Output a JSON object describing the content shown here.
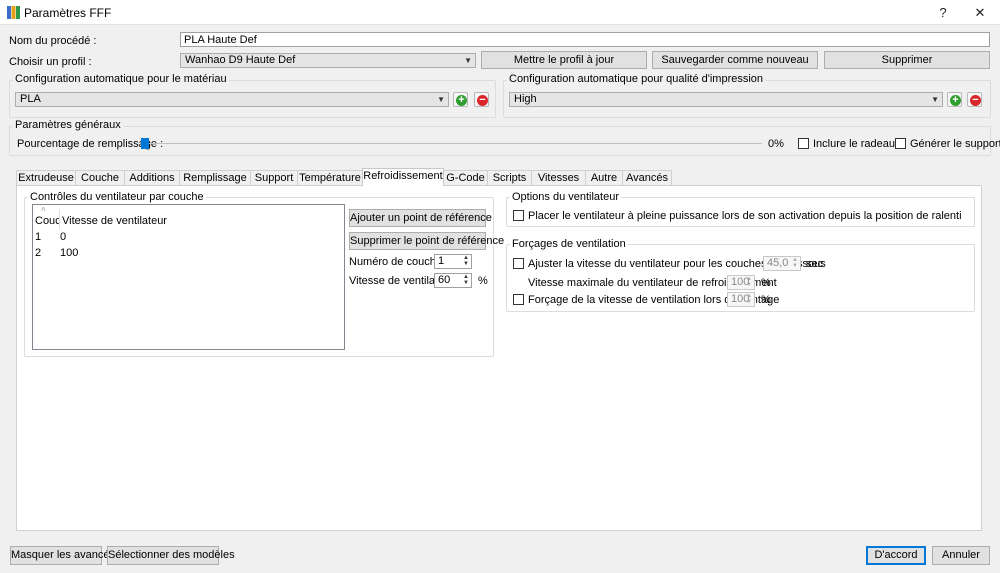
{
  "window": {
    "title": "Paramètres FFF",
    "help_glyph": "?",
    "close_glyph": "✕"
  },
  "process": {
    "name_label": "Nom du procédé :",
    "name_value": "PLA Haute Def"
  },
  "profile": {
    "label": "Choisir un profil :",
    "value": "Wanhao D9 Haute Def",
    "update_button": "Mettre le profil à jour",
    "save_new_button": "Sauvegarder comme nouveau",
    "delete_button": "Supprimer"
  },
  "material": {
    "group_title": "Configuration automatique pour le matériau",
    "value": "PLA"
  },
  "quality": {
    "group_title": "Configuration automatique pour qualité d'impression",
    "value": "High"
  },
  "general": {
    "group_title": "Paramètres généraux",
    "infill_label": "Pourcentage de remplissage :",
    "infill_percent": 0,
    "infill_text": "0%",
    "raft_label": "Inclure le radeau",
    "support_label": "Générer le support"
  },
  "tabs": [
    {
      "label": "Extrudeuse"
    },
    {
      "label": "Couche"
    },
    {
      "label": "Additions"
    },
    {
      "label": "Remplissage"
    },
    {
      "label": "Support"
    },
    {
      "label": "Température"
    },
    {
      "label": "Refroidissement"
    },
    {
      "label": "G-Code"
    },
    {
      "label": "Scripts"
    },
    {
      "label": "Vitesses"
    },
    {
      "label": "Autre"
    },
    {
      "label": "Avancés"
    }
  ],
  "cooling": {
    "fan_control_title": "Contrôles du ventilateur par couche",
    "table_headers": [
      "Couc",
      "Vitesse de ventilateur"
    ],
    "table_rows": [
      [
        "1",
        "0"
      ],
      [
        "2",
        "100"
      ]
    ],
    "add_point_button": "Ajouter un point de référence",
    "remove_point_button": "Supprimer le point de référence",
    "layer_number_label": "Numéro de couche",
    "layer_number_value": "1",
    "fan_speed_label": "Vitesse de ventilateur",
    "fan_speed_value": "60",
    "fan_speed_unit": "%",
    "fan_options_title": "Options du ventilateur",
    "full_power_label": "Placer le ventilateur à pleine puissance lors de son activation depuis la position de ralenti",
    "overrides_title": "Forçages de ventilation",
    "adjust_label": "Ajuster la vitesse du ventilateur pour les couches en dessous",
    "adjust_value": "45,0",
    "adjust_unit": "sec",
    "max_speed_label": "Vitesse maximale du ventilateur de refroidissement",
    "max_speed_value": "100",
    "max_speed_unit": "%",
    "bridge_label": "Forçage de la vitesse de ventilation lors de pontage",
    "bridge_value": "100",
    "bridge_unit": "%"
  },
  "footer": {
    "hide_advanced": "Masquer les avancés",
    "select_models": "Sélectionner des modèles",
    "ok": "D'accord",
    "cancel": "Annuler"
  }
}
